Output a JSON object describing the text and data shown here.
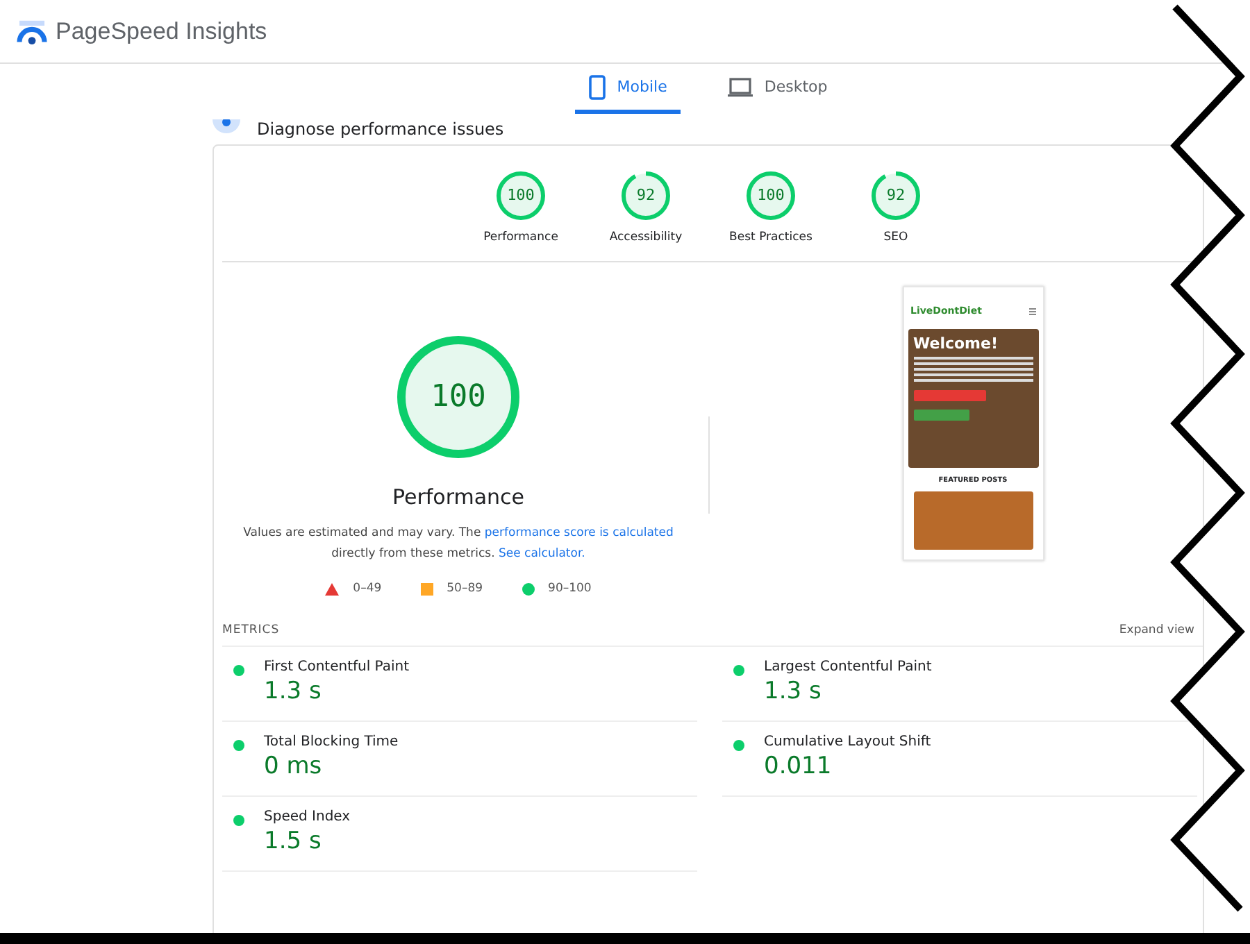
{
  "header": {
    "title": "PageSpeed Insights"
  },
  "tabs": [
    {
      "label": "Mobile",
      "selected": true,
      "kind": "phone"
    },
    {
      "label": "Desktop",
      "selected": false,
      "kind": "laptop"
    }
  ],
  "section_title": "Diagnose performance issues",
  "category_gauges": [
    {
      "score": "100",
      "label": "Performance",
      "level": 1.0
    },
    {
      "score": "92",
      "label": "Accessibility",
      "level": 0.92
    },
    {
      "score": "100",
      "label": "Best Practices",
      "level": 1.0
    },
    {
      "score": "92",
      "label": "SEO",
      "level": 0.92
    }
  ],
  "main_gauge": {
    "score": "100",
    "label": "Performance",
    "level": 1.0
  },
  "note": {
    "text": "Values are estimated and may vary. The",
    "link1": "performance score is calculated",
    "text2": "directly from these metrics.",
    "link2": "See calculator."
  },
  "legend": [
    {
      "kind": "triangle",
      "color": "#e53935",
      "label": "0–49"
    },
    {
      "kind": "square",
      "color": "#ffa726",
      "label": "50–89"
    },
    {
      "kind": "circle",
      "color": "#0cce6b",
      "label": "90–100"
    }
  ],
  "preview": {
    "logo": "LiveDontDiet",
    "heading": "Welcome!",
    "featured": "FEATURED POSTS"
  },
  "metrics": {
    "title": "METRICS",
    "expand": "Expand view",
    "items": [
      {
        "name": "First Contentful Paint",
        "value": "1.3 s",
        "color": "#0cce6b"
      },
      {
        "name": "Largest Contentful Paint",
        "value": "1.3 s",
        "color": "#0cce6b"
      },
      {
        "name": "Total Blocking Time",
        "value": "0 ms",
        "color": "#0cce6b"
      },
      {
        "name": "Cumulative Layout Shift",
        "value": "0.011",
        "color": "#0cce6b"
      },
      {
        "name": "Speed Index",
        "value": "1.5 s",
        "color": "#0cce6b"
      }
    ]
  }
}
